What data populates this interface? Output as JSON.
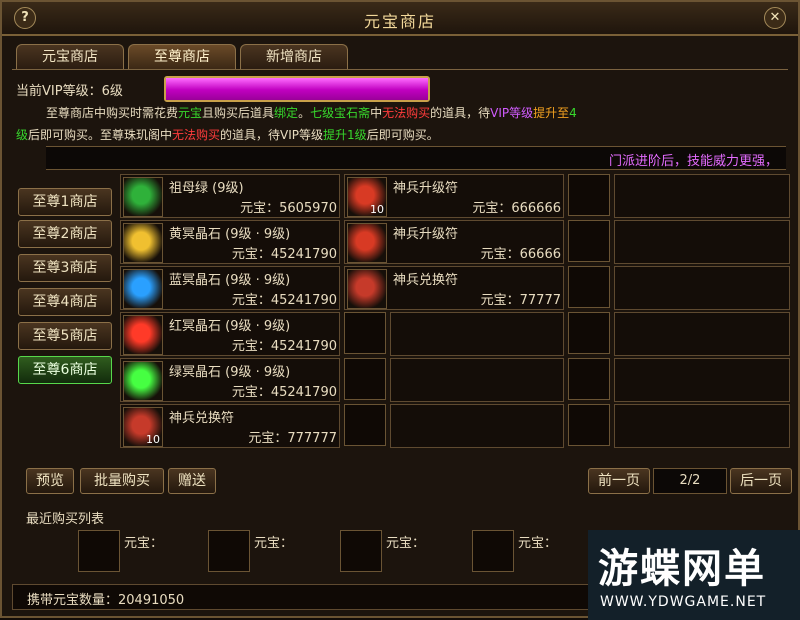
{
  "window": {
    "title": "元宝商店",
    "help": "?",
    "close": "✕"
  },
  "tabs": [
    "元宝商店",
    "至尊商店",
    "新增商店"
  ],
  "vip": {
    "label": "当前VIP等级：6级",
    "progress": 1.0
  },
  "info": {
    "l1_a": "至尊商店中购买时需花费",
    "l1_b": "元宝",
    "l1_c": "且购买后道具",
    "l1_d": "绑定",
    "l1_e": "。",
    "l1_f": "七级宝石斋",
    "l1_g": "中",
    "l1_h": "无法购买",
    "l1_i": "的道具，待",
    "l1_j": "VIP等级",
    "l1_k": "提升至",
    "l1_l": "4",
    "l2_a": "级",
    "l2_b": "后即可购买。至尊珠玑阁中",
    "l2_c": "无法购买",
    "l2_d": "的道具，待VIP等级",
    "l2_e": "提升1级",
    "l2_f": "后即可购买。"
  },
  "banner": "门派进阶后，技能威力更强，",
  "side_menu": [
    "至尊1商店",
    "至尊2商店",
    "至尊3商店",
    "至尊4商店",
    "至尊5商店",
    "至尊6商店"
  ],
  "side_active_index": 5,
  "col1": [
    {
      "name": "祖母绿 (9级)",
      "price": "元宝：5605970",
      "icon": "green-ring-icon",
      "color": "#2fb13a"
    },
    {
      "name": "黄冥晶石 (9级 · 9级)",
      "price": "元宝：45241790",
      "icon": "yellow-crystal-icon",
      "color": "#f0c030"
    },
    {
      "name": "蓝冥晶石 (9级 · 9级)",
      "price": "元宝：45241790",
      "icon": "blue-crystal-icon",
      "color": "#2aa0ff"
    },
    {
      "name": "红冥晶石 (9级 · 9级)",
      "price": "元宝：45241790",
      "icon": "red-crystal-icon",
      "color": "#ff3a28"
    },
    {
      "name": "绿冥晶石 (9级 · 9级)",
      "price": "元宝：45241790",
      "icon": "green-crystal-icon",
      "color": "#46ff42"
    },
    {
      "name": "神兵兑换符",
      "price": "元宝：777777",
      "icon": "scroll-icon",
      "color": "#c63a2a",
      "count": "10"
    }
  ],
  "col2": [
    {
      "name": "神兵升级符",
      "price": "元宝：666666",
      "icon": "flame-icon",
      "color": "#d83a24",
      "count": "10"
    },
    {
      "name": "神兵升级符",
      "price": "元宝：66666",
      "icon": "flame-icon",
      "color": "#d83a24"
    },
    {
      "name": "神兵兑换符",
      "price": "元宝：77777",
      "icon": "scroll-icon",
      "color": "#c63a2a"
    }
  ],
  "buttons": {
    "preview": "预览",
    "bulk": "批量购买",
    "gift": "赠送",
    "prev": "前一页",
    "next": "后一页",
    "page": "2/2"
  },
  "recent": {
    "title": "最近购买列表",
    "label": "元宝："
  },
  "footer": {
    "balance": "携带元宝数量：20491050"
  },
  "watermark": {
    "big": "游蝶网单",
    "small": "WWW.YDWGAME.NET"
  }
}
